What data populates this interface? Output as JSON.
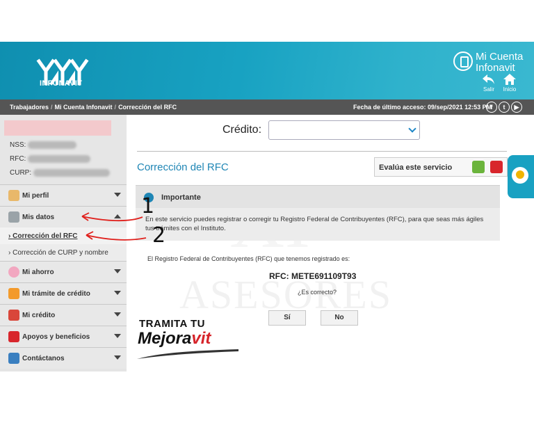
{
  "header": {
    "brand": "INFONAVIT",
    "account_line1": "Mi Cuenta",
    "account_line2": "Infonavit",
    "logout_label": "Salir",
    "home_label": "Inicio"
  },
  "breadcrumb": {
    "items": [
      "Trabajadores",
      "Mi Cuenta Infonavit",
      "Corrección del RFC"
    ],
    "last_access": "Fecha de último acceso: 09/sep/2021 12:53 PM",
    "social": [
      "f",
      "t",
      "▶"
    ]
  },
  "user": {
    "nss_label": "NSS:",
    "rfc_label": "RFC:",
    "curp_label": "CURP:"
  },
  "menu": {
    "mi_perfil": "Mi perfil",
    "mis_datos": "Mis datos",
    "correccion_rfc": "Corrección del RFC",
    "correccion_curp": "Corrección de CURP y nombre",
    "mi_ahorro": "Mi ahorro",
    "mi_tramite": "Mi trámite de crédito",
    "mi_credito": "Mi crédito",
    "apoyos": "Apoyos y beneficios",
    "contactanos": "Contáctanos"
  },
  "main": {
    "credito_label": "Crédito:",
    "page_title": "Corrección del RFC",
    "evalua_label": "Evalúa este servicio",
    "importante_title": "Importante",
    "importante_body": "En este servicio puedes registrar o corregir tu Registro Federal de Contribuyentes (RFC), para que seas más ágiles tus trámites con el Instituto.",
    "registered_text": "El Registro Federal de Contribuyentes (RFC) que tenemos registrado es:",
    "rfc_value": "RFC: METE691109T93",
    "question": "¿Es correcto?",
    "yes_label": "Sí",
    "no_label": "No"
  },
  "watermark": {
    "letters": "XI",
    "word": "ASESORES"
  },
  "promo": {
    "line1": "TRAMITA TU",
    "line2_black": "Mejora",
    "line2_red": "vit"
  },
  "annotations": {
    "one": "1",
    "two": "2"
  },
  "colors": {
    "header": "#18a2c2",
    "breadcrumb_bar": "#555555",
    "accent_blue": "#1f86b5",
    "annotation_arrow": "#e0201c",
    "promo_red": "#d6242a"
  }
}
